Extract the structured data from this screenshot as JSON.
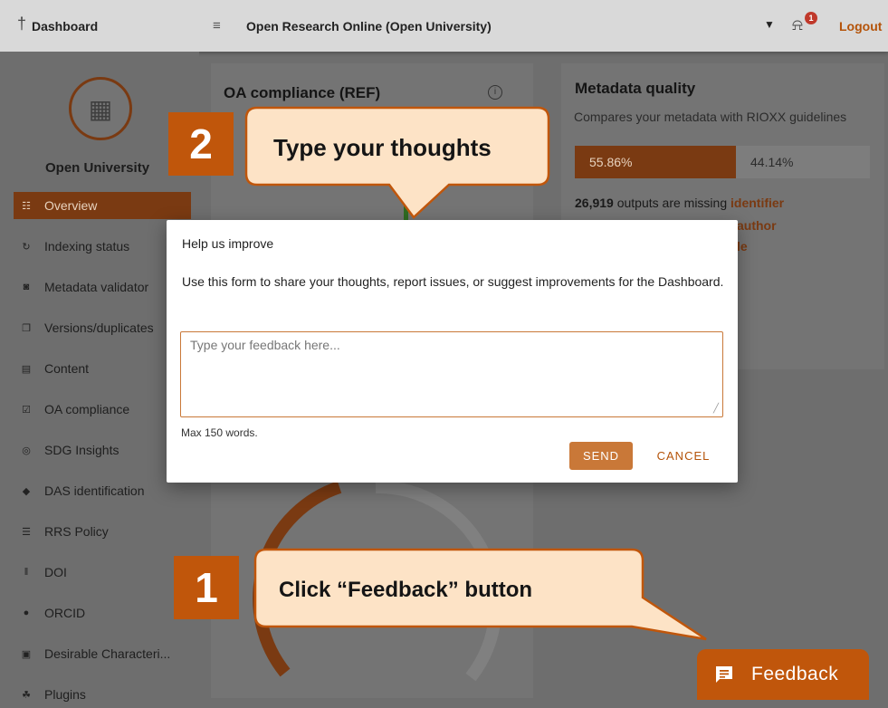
{
  "topbar": {
    "title": "Dashboard",
    "repository": "Open Research Online (Open University)",
    "notification_count": "1",
    "logout_label": "Logout"
  },
  "sidebar": {
    "org_name": "Open University",
    "items": [
      {
        "label": "Overview",
        "icon": "grid-icon",
        "active": true
      },
      {
        "label": "Indexing status",
        "icon": "sync-icon"
      },
      {
        "label": "Metadata validator",
        "icon": "validator-icon"
      },
      {
        "label": "Versions/duplicates",
        "icon": "copy-icon"
      },
      {
        "label": "Content",
        "icon": "document-icon"
      },
      {
        "label": "OA compliance",
        "icon": "calendar-check-icon"
      },
      {
        "label": "SDG Insights",
        "icon": "sdg-icon"
      },
      {
        "label": "DAS identification",
        "icon": "das-icon"
      },
      {
        "label": "RRS Policy",
        "icon": "policy-icon"
      },
      {
        "label": "DOI",
        "icon": "barcode-icon"
      },
      {
        "label": "ORCID",
        "icon": "orcid-icon"
      },
      {
        "label": "Desirable Characteri...",
        "icon": "file-check-icon"
      },
      {
        "label": "Plugins",
        "icon": "puzzle-icon"
      }
    ]
  },
  "oa_card": {
    "title": "OA compliance (REF)"
  },
  "metadata_card": {
    "title": "Metadata quality",
    "subtitle": "Compares your metadata with RIOXX guidelines",
    "bar_left_label": "55.86%",
    "bar_left_value": 55.86,
    "bar_right_label": "44.14%",
    "missing_count": "26,919",
    "missing_text": " outputs are missing ",
    "missing_field": "identifier",
    "fragment_author": "author",
    "fragment_le": "le"
  },
  "modal": {
    "title": "Help us improve",
    "description": "Use this form to share your thoughts, report issues, or suggest improvements for the Dashboard.",
    "placeholder": "Type your feedback here...",
    "hint": "Max 150 words.",
    "send_label": "SEND",
    "cancel_label": "CANCEL"
  },
  "annotations": {
    "step1_number": "1",
    "step1_text": "Click “Feedback” button",
    "step2_number": "2",
    "step2_text": "Type your thoughts"
  },
  "feedback_button": {
    "label": "Feedback",
    "icon": "chat-icon"
  },
  "colors": {
    "accent_dark": "#7a3a12",
    "accent": "#c0560b",
    "send": "#c97838",
    "callout_fill": "#fde3c6",
    "callout_stroke": "#c0560b"
  }
}
